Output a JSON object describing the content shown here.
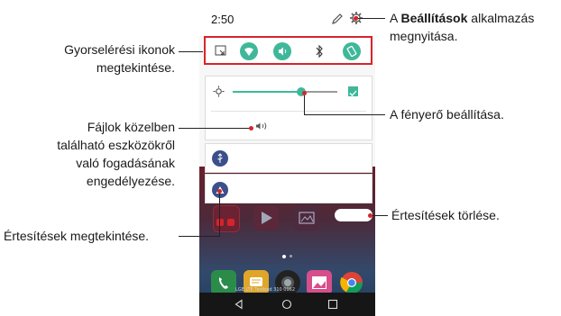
{
  "phone": {
    "time": "2:50",
    "carrier_text": "LGE LTE Testbed 310 0962"
  },
  "callouts": {
    "settings_prefix": "A ",
    "settings_bold": "Beállítások",
    "settings_suffix": " alkalmazás",
    "settings_line2": "megnyitása.",
    "quick_line1": "Gyorselérési ikonok",
    "quick_line2": "megtekintése.",
    "brightness": "A fényerő beállítása.",
    "nearby_line1": "Fájlok közelben",
    "nearby_line2": "található eszközökről",
    "nearby_line3": "való fogadásának",
    "nearby_line4": "engedélyezése.",
    "clear": "Értesítések törlése.",
    "view": "Értesítések megtekintése."
  },
  "colors": {
    "accent": "#3fb89a",
    "callout_dot": "#d6242b",
    "badge": "#3b4f8a"
  },
  "icons": {
    "edit": "pencil-icon",
    "settings": "gear-icon",
    "quick": [
      "screen-icon",
      "wifi-icon",
      "sound-icon",
      "bluetooth-icon",
      "rotate-icon"
    ],
    "nav": [
      "back-icon",
      "home-icon",
      "recents-icon"
    ]
  }
}
